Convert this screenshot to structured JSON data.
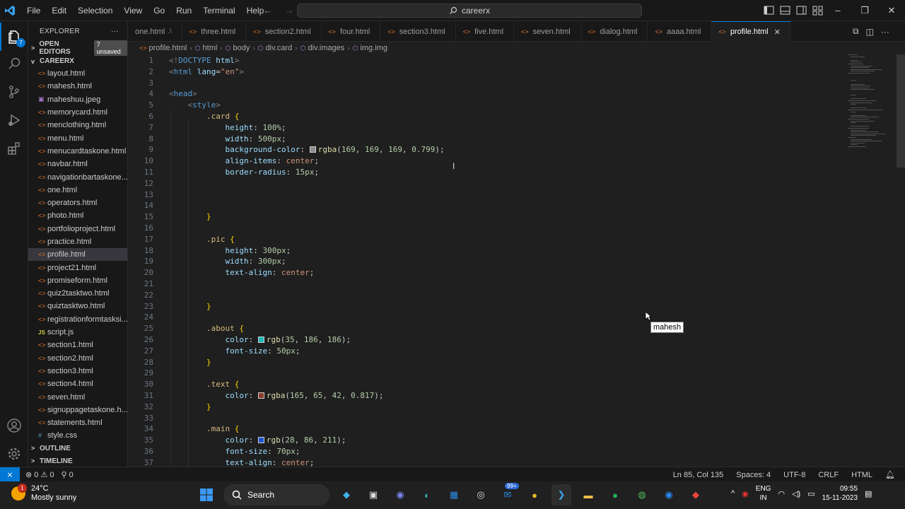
{
  "menu": [
    "File",
    "Edit",
    "Selection",
    "View",
    "Go",
    "Run",
    "Terminal",
    "Help"
  ],
  "search": {
    "label": "careerx"
  },
  "explorer": {
    "title": "EXPLORER",
    "open_editors": "OPEN EDITORS",
    "unsaved": "7 unsaved",
    "folder": "CAREERX",
    "files": [
      {
        "name": "layout.html",
        "type": "html"
      },
      {
        "name": "mahesh.html",
        "type": "html"
      },
      {
        "name": "maheshuu.jpeg",
        "type": "img"
      },
      {
        "name": "memorycard.html",
        "type": "html"
      },
      {
        "name": "menclothing.html",
        "type": "html"
      },
      {
        "name": "menu.html",
        "type": "html"
      },
      {
        "name": "menucardtaskone.html",
        "type": "html"
      },
      {
        "name": "navbar.html",
        "type": "html"
      },
      {
        "name": "navigationbartaskone...",
        "type": "html"
      },
      {
        "name": "one.html",
        "type": "html"
      },
      {
        "name": "operators.html",
        "type": "html"
      },
      {
        "name": "photo.html",
        "type": "html"
      },
      {
        "name": "portfolioproject.html",
        "type": "html"
      },
      {
        "name": "practice.html",
        "type": "html"
      },
      {
        "name": "profile.html",
        "type": "html"
      },
      {
        "name": "project21.html",
        "type": "html"
      },
      {
        "name": "promiseform.html",
        "type": "html"
      },
      {
        "name": "quiz2tasktwo.html",
        "type": "html"
      },
      {
        "name": "quiztasktwo.html",
        "type": "html"
      },
      {
        "name": "registrationformtasksi...",
        "type": "html"
      },
      {
        "name": "script.js",
        "type": "js"
      },
      {
        "name": "section1.html",
        "type": "html"
      },
      {
        "name": "section2.html",
        "type": "html"
      },
      {
        "name": "section3.html",
        "type": "html"
      },
      {
        "name": "section4.html",
        "type": "html"
      },
      {
        "name": "seven.html",
        "type": "html"
      },
      {
        "name": "signuppagetaskone.h...",
        "type": "html"
      },
      {
        "name": "statements.html",
        "type": "html"
      },
      {
        "name": "style.css",
        "type": "css"
      }
    ],
    "selected": "profile.html",
    "outline": "OUTLINE",
    "timeline": "TIMELINE"
  },
  "tabs": [
    {
      "label": "one.html",
      "suffix": ".\\"
    },
    {
      "label": "three.html"
    },
    {
      "label": "section2.html"
    },
    {
      "label": "four.html"
    },
    {
      "label": "section3.html"
    },
    {
      "label": "five.html"
    },
    {
      "label": "seven.html"
    },
    {
      "label": "dialog.html"
    },
    {
      "label": "aaaa.html"
    },
    {
      "label": "profile.html",
      "active": true
    }
  ],
  "breadcrumb": [
    "profile.html",
    "html",
    "body",
    "div.card",
    "div.images",
    "img.img"
  ],
  "editor": {
    "lines": [
      {
        "n": "1",
        "html": "<span class='k-br'>&lt;!</span><span class='k-tag'>DOCTYPE</span> <span class='k-attr'>html</span><span class='k-br'>&gt;</span>"
      },
      {
        "n": "2",
        "html": "<span class='k-br'>&lt;</span><span class='k-tag'>html</span> <span class='k-attr'>lang</span><span class='k-punc'>=</span><span class='k-str'>\"en\"</span><span class='k-br'>&gt;</span>"
      },
      {
        "n": "3",
        "html": ""
      },
      {
        "n": "4",
        "html": "<span class='k-br'>&lt;</span><span class='k-tag'>head</span><span class='k-br'>&gt;</span>"
      },
      {
        "n": "5",
        "html": "    <span class='k-br'>&lt;</span><span class='k-tag'>style</span><span class='k-br'>&gt;</span>"
      },
      {
        "n": "6",
        "html": "        <span class='k-sel'>.card</span> <span class='k-brace'>{</span>"
      },
      {
        "n": "7",
        "html": "            <span class='k-prop'>height</span><span class='k-punc'>: </span><span class='k-num'>100%</span><span class='k-punc'>;</span>"
      },
      {
        "n": "8",
        "html": "            <span class='k-prop'>width</span><span class='k-punc'>: </span><span class='k-num'>500px</span><span class='k-punc'>;</span>"
      },
      {
        "n": "9",
        "html": "            <span class='k-prop'>background-color</span><span class='k-punc'>: </span><span class='swatch' style='background:rgba(169,169,169,0.799)'></span><span class='k-fn'>rgba</span><span class='k-punc'>(</span><span class='k-num'>169</span><span class='k-punc'>, </span><span class='k-num'>169</span><span class='k-punc'>, </span><span class='k-num'>169</span><span class='k-punc'>, </span><span class='k-num'>0.799</span><span class='k-punc'>);</span>"
      },
      {
        "n": "10",
        "html": "            <span class='k-prop'>align-items</span><span class='k-punc'>: </span><span class='k-val'>center</span><span class='k-punc'>;</span>"
      },
      {
        "n": "11",
        "html": "            <span class='k-prop'>border-radius</span><span class='k-punc'>: </span><span class='k-num'>15px</span><span class='k-punc'>;</span>"
      },
      {
        "n": "12",
        "html": ""
      },
      {
        "n": "13",
        "html": ""
      },
      {
        "n": "14",
        "html": ""
      },
      {
        "n": "15",
        "html": "        <span class='k-brace'>}</span>"
      },
      {
        "n": "16",
        "html": ""
      },
      {
        "n": "17",
        "html": "        <span class='k-sel'>.pic</span> <span class='k-brace'>{</span>"
      },
      {
        "n": "18",
        "html": "            <span class='k-prop'>height</span><span class='k-punc'>: </span><span class='k-num'>300px</span><span class='k-punc'>;</span>"
      },
      {
        "n": "19",
        "html": "            <span class='k-prop'>width</span><span class='k-punc'>: </span><span class='k-num'>300px</span><span class='k-punc'>;</span>"
      },
      {
        "n": "20",
        "html": "            <span class='k-prop'>text-align</span><span class='k-punc'>: </span><span class='k-val'>center</span><span class='k-punc'>;</span>"
      },
      {
        "n": "21",
        "html": ""
      },
      {
        "n": "22",
        "html": ""
      },
      {
        "n": "23",
        "html": "        <span class='k-brace'>}</span>"
      },
      {
        "n": "24",
        "html": ""
      },
      {
        "n": "25",
        "html": "        <span class='k-sel'>.about</span> <span class='k-brace'>{</span>"
      },
      {
        "n": "26",
        "html": "            <span class='k-prop'>color</span><span class='k-punc'>: </span><span class='swatch' style='background:rgb(35,186,186)'></span><span class='k-fn'>rgb</span><span class='k-punc'>(</span><span class='k-num'>35</span><span class='k-punc'>, </span><span class='k-num'>186</span><span class='k-punc'>, </span><span class='k-num'>186</span><span class='k-punc'>);</span>"
      },
      {
        "n": "27",
        "html": "            <span class='k-prop'>font-size</span><span class='k-punc'>: </span><span class='k-num'>50px</span><span class='k-punc'>;</span>"
      },
      {
        "n": "28",
        "html": "        <span class='k-brace'>}</span>"
      },
      {
        "n": "29",
        "html": ""
      },
      {
        "n": "30",
        "html": "        <span class='k-sel'>.text</span> <span class='k-brace'>{</span>"
      },
      {
        "n": "31",
        "html": "            <span class='k-prop'>color</span><span class='k-punc'>: </span><span class='swatch' style='background:rgba(165,65,42,0.817)'></span><span class='k-fn'>rgba</span><span class='k-punc'>(</span><span class='k-num'>165</span><span class='k-punc'>, </span><span class='k-num'>65</span><span class='k-punc'>, </span><span class='k-num'>42</span><span class='k-punc'>, </span><span class='k-num'>0.817</span><span class='k-punc'>);</span>"
      },
      {
        "n": "32",
        "html": "        <span class='k-brace'>}</span>"
      },
      {
        "n": "33",
        "html": ""
      },
      {
        "n": "34",
        "html": "        <span class='k-sel'>.main</span> <span class='k-brace'>{</span>"
      },
      {
        "n": "35",
        "html": "            <span class='k-prop'>color</span><span class='k-punc'>: </span><span class='swatch' style='background:rgb(28,86,211)'></span><span class='k-fn'>rgb</span><span class='k-punc'>(</span><span class='k-num'>28</span><span class='k-punc'>, </span><span class='k-num'>86</span><span class='k-punc'>, </span><span class='k-num'>211</span><span class='k-punc'>);</span>"
      },
      {
        "n": "36",
        "html": "            <span class='k-prop'>font-size</span><span class='k-punc'>: </span><span class='k-num'>70px</span><span class='k-punc'>;</span>"
      },
      {
        "n": "37",
        "html": "            <span class='k-prop'>text-align</span><span class='k-punc'>: </span><span class='k-val'>center</span><span class='k-punc'>;</span>"
      }
    ]
  },
  "tooltip": "mahesh",
  "status": {
    "errors": "0",
    "warnings": "0",
    "ports": "0",
    "position": "Ln 85, Col 135",
    "spaces": "Spaces: 4",
    "encoding": "UTF-8",
    "eol": "CRLF",
    "language": "HTML"
  },
  "taskbar": {
    "weather_badge": "1",
    "temperature": "24°C",
    "condition": "Mostly sunny",
    "search": "Search",
    "mail_badge": "99+",
    "lang_top": "ENG",
    "lang_bottom": "IN",
    "time": "09:55",
    "date": "15-11-2023"
  },
  "colors": {
    "accent": "#0078d4",
    "html_icon": "#e37933",
    "editor_bg": "#1f1f1f",
    "chrome_bg": "#181818"
  }
}
